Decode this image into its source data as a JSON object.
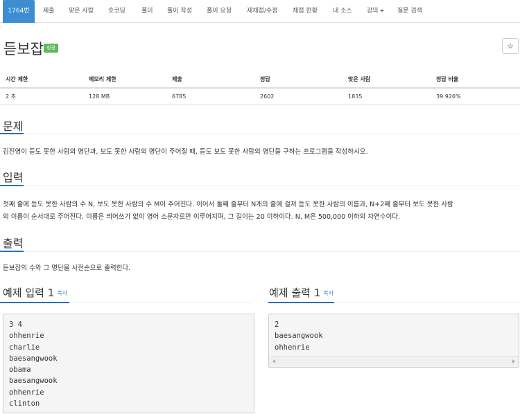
{
  "nav": {
    "items": [
      {
        "label": "1764번",
        "active": true
      },
      {
        "label": "제출"
      },
      {
        "label": "맞은 사람"
      },
      {
        "label": "숏코딩"
      },
      {
        "label": "풀이"
      },
      {
        "label": "풀이 작성"
      },
      {
        "label": "풀이 요청"
      },
      {
        "label": "재채점/수정"
      },
      {
        "label": "채점 현황"
      },
      {
        "label": "내 소스"
      },
      {
        "label": "강의",
        "dropdown": true
      },
      {
        "label": "질문 검색"
      }
    ]
  },
  "problem": {
    "title": "듣보잡",
    "status_badge": "성공",
    "star_icon": "☆"
  },
  "info": {
    "headers": [
      "시간 제한",
      "메모리 제한",
      "제출",
      "정답",
      "맞은 사람",
      "정답 비율"
    ],
    "values": [
      "2 초",
      "128 MB",
      "6785",
      "2602",
      "1835",
      "39.926%"
    ]
  },
  "sections": {
    "problem": {
      "heading": "문제",
      "text": "김진영이 듣도 못한 사람의 명단과, 보도 못한 사람의 명단이 주어질 때, 듣도 보도 못한 사람의 명단을 구하는 프로그램을 작성하시오."
    },
    "input": {
      "heading": "입력",
      "line1": "첫째 줄에 듣도 못한 사람의 수 N, 보도 못한 사람의 수 M이 주어진다. 이어서 둘째 줄부터 N개의 줄에 걸쳐 듣도 못한 사람의 이름과, N+2째 줄부터 보도 못한 사람",
      "line2": "의 이름이 순서대로 주어진다. 이름은 띄어쓰기 없이 영어 소문자로만 이루어지며, 그 길이는 20 이하이다. N, M은 500,000 이하의 자연수이다."
    },
    "output": {
      "heading": "출력",
      "text": "듣보잡의 수와 그 명단을 사전순으로 출력한다."
    }
  },
  "samples": {
    "input": {
      "heading": "예제 입력 1",
      "copy": "복사",
      "text": "3 4\nohhenrie\ncharlie\nbaesangwook\nobama\nbaesangwook\nohhenrie\nclinton"
    },
    "output": {
      "heading": "예제 출력 1",
      "copy": "복사",
      "text": "2\nbaesangwook\nohhenrie"
    }
  },
  "colors": {
    "accent": "#3c8dd1",
    "success": "#5cb85c",
    "link": "#337ab7"
  }
}
